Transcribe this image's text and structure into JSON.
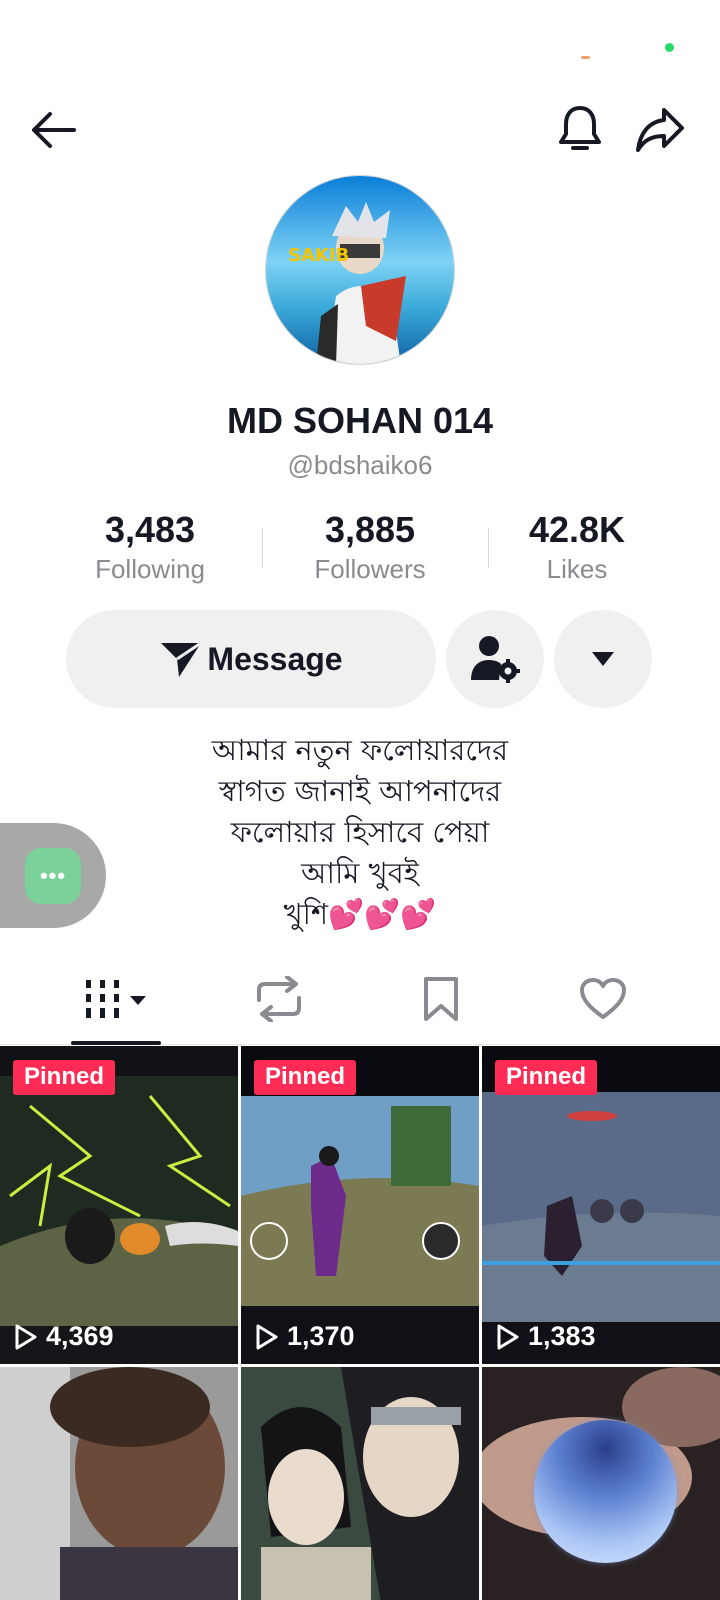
{
  "profile": {
    "display_name": "MD SOHAN 014",
    "handle": "@bdshaiko6",
    "avatar_text": "SAKIB"
  },
  "stats": [
    {
      "value": "3,483",
      "label": "Following"
    },
    {
      "value": "3,885",
      "label": "Followers"
    },
    {
      "value": "42.8K",
      "label": "Likes"
    }
  ],
  "actions": {
    "message_label": "Message"
  },
  "bio": {
    "lines": [
      "আমার নতুন ফলোয়ারদের",
      "স্বাগত জানাই আপনাদের",
      "ফলোয়ার হিসাবে পেয়া",
      "আমি খুবই",
      "খুশি"
    ],
    "emoji": "💕💕💕"
  },
  "videos": [
    {
      "pinned": "Pinned",
      "views": "4,369"
    },
    {
      "pinned": "Pinned",
      "views": "1,370"
    },
    {
      "pinned": "Pinned",
      "views": "1,383"
    }
  ],
  "icons": {
    "back": "arrow-left-icon",
    "bell": "bell-icon",
    "share": "share-arrow-icon",
    "message": "paper-plane-icon",
    "friends": "user-gear-icon",
    "more": "caret-down-icon",
    "tab_videos": "grid-bars-icon",
    "tab_reposts": "repost-icon",
    "tab_saved": "bookmark-icon",
    "tab_liked": "heart-icon",
    "views": "play-icon"
  },
  "colors": {
    "pinned_badge": "#fe2c55",
    "accent_text": "#161823",
    "secondary_text": "#8a8b91",
    "button_bg": "#f0f0f1"
  }
}
